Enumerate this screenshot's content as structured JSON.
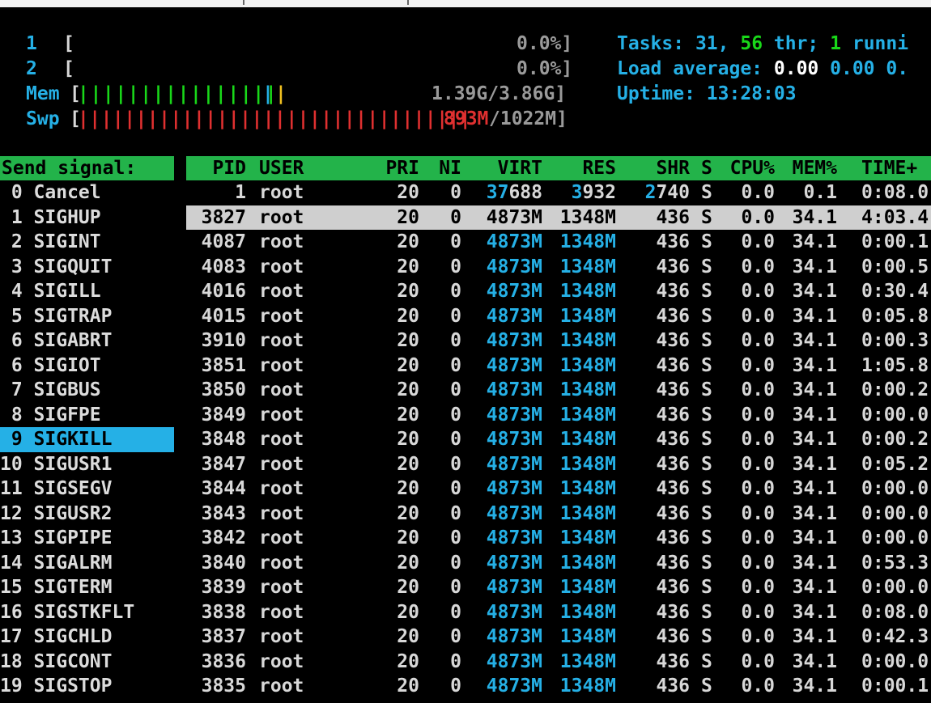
{
  "meters": {
    "cpu1": {
      "label": "1",
      "bar": "[",
      "value": "0.0%]"
    },
    "cpu2": {
      "label": "2",
      "bar": "[",
      "value": "0.0%]"
    },
    "mem": {
      "label": "Mem",
      "open": "[",
      "bars_green": "||||||||||||||||",
      "bars_blue": "|",
      "bars_yellow": "|",
      "value": "1.39G/3.86G]"
    },
    "swp": {
      "label": "Swp",
      "open": "[",
      "bars_red": "||||||||||||||||||||||||||||||||||",
      "value_red": "893M",
      "value_rest": "/1022M]"
    }
  },
  "summary": {
    "tasks_label": "Tasks: ",
    "tasks": "31",
    "comma": ", ",
    "thr": "56",
    "thr_label": " thr; ",
    "running": "1",
    "running_label": " runni",
    "load_label": "Load average: ",
    "load1": "0.00",
    "load5": "0.00",
    "load15": "0.",
    "uptime_label": "Uptime: ",
    "uptime": "13:28:03"
  },
  "signal_panel": {
    "header": "Send signal:",
    "selected_index": 10,
    "signals": [
      " 0 Cancel",
      " 1 SIGHUP",
      " 2 SIGINT",
      " 3 SIGQUIT",
      " 4 SIGILL",
      " 5 SIGTRAP",
      " 6 SIGABRT",
      " 6 SIGIOT",
      " 7 SIGBUS",
      " 8 SIGFPE",
      " 9 SIGKILL",
      "10 SIGUSR1",
      "11 SIGSEGV",
      "12 SIGUSR2",
      "13 SIGPIPE",
      "14 SIGALRM",
      "15 SIGTERM",
      "16 SIGSTKFLT",
      "17 SIGCHLD",
      "18 SIGCONT",
      "19 SIGSTOP"
    ]
  },
  "process_table": {
    "columns": [
      "PID",
      "USER",
      "PRI",
      "NI",
      "VIRT",
      "RES",
      "SHR",
      "S",
      "CPU%",
      "MEM%",
      "TIME+"
    ],
    "selected_index": 1,
    "rows": [
      {
        "pid": "1",
        "user": "root",
        "pri": "20",
        "ni": "0",
        "virt_a": "37",
        "virt_b": "688",
        "res_a": "3",
        "res_b": "932",
        "shr_a": "2",
        "shr_b": "740",
        "s": "S",
        "cpu": "0.0",
        "mem": "0.1",
        "time": "0:08.0"
      },
      {
        "pid": "3827",
        "user": "root",
        "pri": "20",
        "ni": "0",
        "virt_a": "4873M",
        "virt_b": "",
        "res_a": "1348M",
        "res_b": "",
        "shr_a": "",
        "shr_b": "436",
        "s": "S",
        "cpu": "0.0",
        "mem": "34.1",
        "time": "4:03.4"
      },
      {
        "pid": "4087",
        "user": "root",
        "pri": "20",
        "ni": "0",
        "virt_a": "4873M",
        "virt_b": "",
        "res_a": "1348M",
        "res_b": "",
        "shr_a": "",
        "shr_b": "436",
        "s": "S",
        "cpu": "0.0",
        "mem": "34.1",
        "time": "0:00.1"
      },
      {
        "pid": "4083",
        "user": "root",
        "pri": "20",
        "ni": "0",
        "virt_a": "4873M",
        "virt_b": "",
        "res_a": "1348M",
        "res_b": "",
        "shr_a": "",
        "shr_b": "436",
        "s": "S",
        "cpu": "0.0",
        "mem": "34.1",
        "time": "0:00.5"
      },
      {
        "pid": "4016",
        "user": "root",
        "pri": "20",
        "ni": "0",
        "virt_a": "4873M",
        "virt_b": "",
        "res_a": "1348M",
        "res_b": "",
        "shr_a": "",
        "shr_b": "436",
        "s": "S",
        "cpu": "0.0",
        "mem": "34.1",
        "time": "0:30.4"
      },
      {
        "pid": "4015",
        "user": "root",
        "pri": "20",
        "ni": "0",
        "virt_a": "4873M",
        "virt_b": "",
        "res_a": "1348M",
        "res_b": "",
        "shr_a": "",
        "shr_b": "436",
        "s": "S",
        "cpu": "0.0",
        "mem": "34.1",
        "time": "0:05.8"
      },
      {
        "pid": "3910",
        "user": "root",
        "pri": "20",
        "ni": "0",
        "virt_a": "4873M",
        "virt_b": "",
        "res_a": "1348M",
        "res_b": "",
        "shr_a": "",
        "shr_b": "436",
        "s": "S",
        "cpu": "0.0",
        "mem": "34.1",
        "time": "0:00.3"
      },
      {
        "pid": "3851",
        "user": "root",
        "pri": "20",
        "ni": "0",
        "virt_a": "4873M",
        "virt_b": "",
        "res_a": "1348M",
        "res_b": "",
        "shr_a": "",
        "shr_b": "436",
        "s": "S",
        "cpu": "0.0",
        "mem": "34.1",
        "time": "1:05.8"
      },
      {
        "pid": "3850",
        "user": "root",
        "pri": "20",
        "ni": "0",
        "virt_a": "4873M",
        "virt_b": "",
        "res_a": "1348M",
        "res_b": "",
        "shr_a": "",
        "shr_b": "436",
        "s": "S",
        "cpu": "0.0",
        "mem": "34.1",
        "time": "0:00.2"
      },
      {
        "pid": "3849",
        "user": "root",
        "pri": "20",
        "ni": "0",
        "virt_a": "4873M",
        "virt_b": "",
        "res_a": "1348M",
        "res_b": "",
        "shr_a": "",
        "shr_b": "436",
        "s": "S",
        "cpu": "0.0",
        "mem": "34.1",
        "time": "0:00.0"
      },
      {
        "pid": "3848",
        "user": "root",
        "pri": "20",
        "ni": "0",
        "virt_a": "4873M",
        "virt_b": "",
        "res_a": "1348M",
        "res_b": "",
        "shr_a": "",
        "shr_b": "436",
        "s": "S",
        "cpu": "0.0",
        "mem": "34.1",
        "time": "0:00.2"
      },
      {
        "pid": "3847",
        "user": "root",
        "pri": "20",
        "ni": "0",
        "virt_a": "4873M",
        "virt_b": "",
        "res_a": "1348M",
        "res_b": "",
        "shr_a": "",
        "shr_b": "436",
        "s": "S",
        "cpu": "0.0",
        "mem": "34.1",
        "time": "0:05.2"
      },
      {
        "pid": "3844",
        "user": "root",
        "pri": "20",
        "ni": "0",
        "virt_a": "4873M",
        "virt_b": "",
        "res_a": "1348M",
        "res_b": "",
        "shr_a": "",
        "shr_b": "436",
        "s": "S",
        "cpu": "0.0",
        "mem": "34.1",
        "time": "0:00.0"
      },
      {
        "pid": "3843",
        "user": "root",
        "pri": "20",
        "ni": "0",
        "virt_a": "4873M",
        "virt_b": "",
        "res_a": "1348M",
        "res_b": "",
        "shr_a": "",
        "shr_b": "436",
        "s": "S",
        "cpu": "0.0",
        "mem": "34.1",
        "time": "0:00.0"
      },
      {
        "pid": "3842",
        "user": "root",
        "pri": "20",
        "ni": "0",
        "virt_a": "4873M",
        "virt_b": "",
        "res_a": "1348M",
        "res_b": "",
        "shr_a": "",
        "shr_b": "436",
        "s": "S",
        "cpu": "0.0",
        "mem": "34.1",
        "time": "0:00.0"
      },
      {
        "pid": "3840",
        "user": "root",
        "pri": "20",
        "ni": "0",
        "virt_a": "4873M",
        "virt_b": "",
        "res_a": "1348M",
        "res_b": "",
        "shr_a": "",
        "shr_b": "436",
        "s": "S",
        "cpu": "0.0",
        "mem": "34.1",
        "time": "0:53.3"
      },
      {
        "pid": "3839",
        "user": "root",
        "pri": "20",
        "ni": "0",
        "virt_a": "4873M",
        "virt_b": "",
        "res_a": "1348M",
        "res_b": "",
        "shr_a": "",
        "shr_b": "436",
        "s": "S",
        "cpu": "0.0",
        "mem": "34.1",
        "time": "0:00.0"
      },
      {
        "pid": "3838",
        "user": "root",
        "pri": "20",
        "ni": "0",
        "virt_a": "4873M",
        "virt_b": "",
        "res_a": "1348M",
        "res_b": "",
        "shr_a": "",
        "shr_b": "436",
        "s": "S",
        "cpu": "0.0",
        "mem": "34.1",
        "time": "0:08.0"
      },
      {
        "pid": "3837",
        "user": "root",
        "pri": "20",
        "ni": "0",
        "virt_a": "4873M",
        "virt_b": "",
        "res_a": "1348M",
        "res_b": "",
        "shr_a": "",
        "shr_b": "436",
        "s": "S",
        "cpu": "0.0",
        "mem": "34.1",
        "time": "0:42.3"
      },
      {
        "pid": "3836",
        "user": "root",
        "pri": "20",
        "ni": "0",
        "virt_a": "4873M",
        "virt_b": "",
        "res_a": "1348M",
        "res_b": "",
        "shr_a": "",
        "shr_b": "436",
        "s": "S",
        "cpu": "0.0",
        "mem": "34.1",
        "time": "0:00.0"
      },
      {
        "pid": "3835",
        "user": "root",
        "pri": "20",
        "ni": "0",
        "virt_a": "4873M",
        "virt_b": "",
        "res_a": "1348M",
        "res_b": "",
        "shr_a": "",
        "shr_b": "436",
        "s": "S",
        "cpu": "0.0",
        "mem": "34.1",
        "time": "0:00.1"
      }
    ]
  },
  "colors": {
    "header_green": "#23b34a",
    "selection_cyan": "#25b0e6",
    "row_selection": "#cfcfcf"
  }
}
